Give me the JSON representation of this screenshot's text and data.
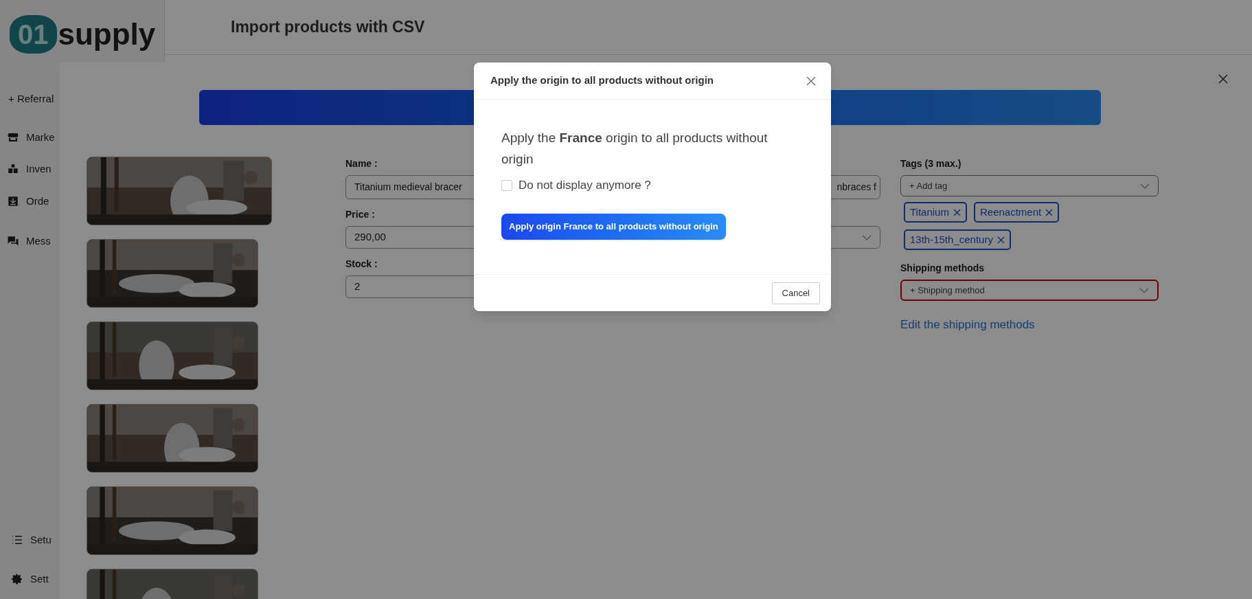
{
  "logo": {
    "prefix": "01",
    "word": "supply"
  },
  "header": {
    "title": "Import products with CSV"
  },
  "sidebar": {
    "referral": "+ Referral",
    "items": [
      {
        "label": "Marke"
      },
      {
        "label": "Inven"
      },
      {
        "label": "Orde"
      },
      {
        "label": "Mess"
      }
    ],
    "bottom_items": [
      {
        "label": "Setu"
      },
      {
        "label": "Sett"
      }
    ]
  },
  "product_form": {
    "name": {
      "label": "Name :",
      "value_start": "Titanium medieval bracer",
      "value_end": "nbraces f"
    },
    "price": {
      "label": "Price :",
      "value": "290,00"
    },
    "stock": {
      "label": "Stock :",
      "value": "2"
    },
    "tags": {
      "label": "Tags (3 max.)",
      "placeholder": "+ Add tag",
      "items": [
        "Titanium",
        "Reenactment",
        "13th-15th_century"
      ]
    },
    "shipping": {
      "label": "Shipping methods",
      "placeholder": "+ Shipping method",
      "invalid": true,
      "link": "Edit the shipping methods"
    }
  },
  "dialog": {
    "title": "Apply the origin to all products without origin",
    "message": "Apply the **France** origin to all products without origin",
    "checkbox": {
      "label": "Do not display anymore ?",
      "checked": false
    },
    "apply_button": "Apply origin France to all products without origin",
    "cancel_button": "Cancel"
  }
}
